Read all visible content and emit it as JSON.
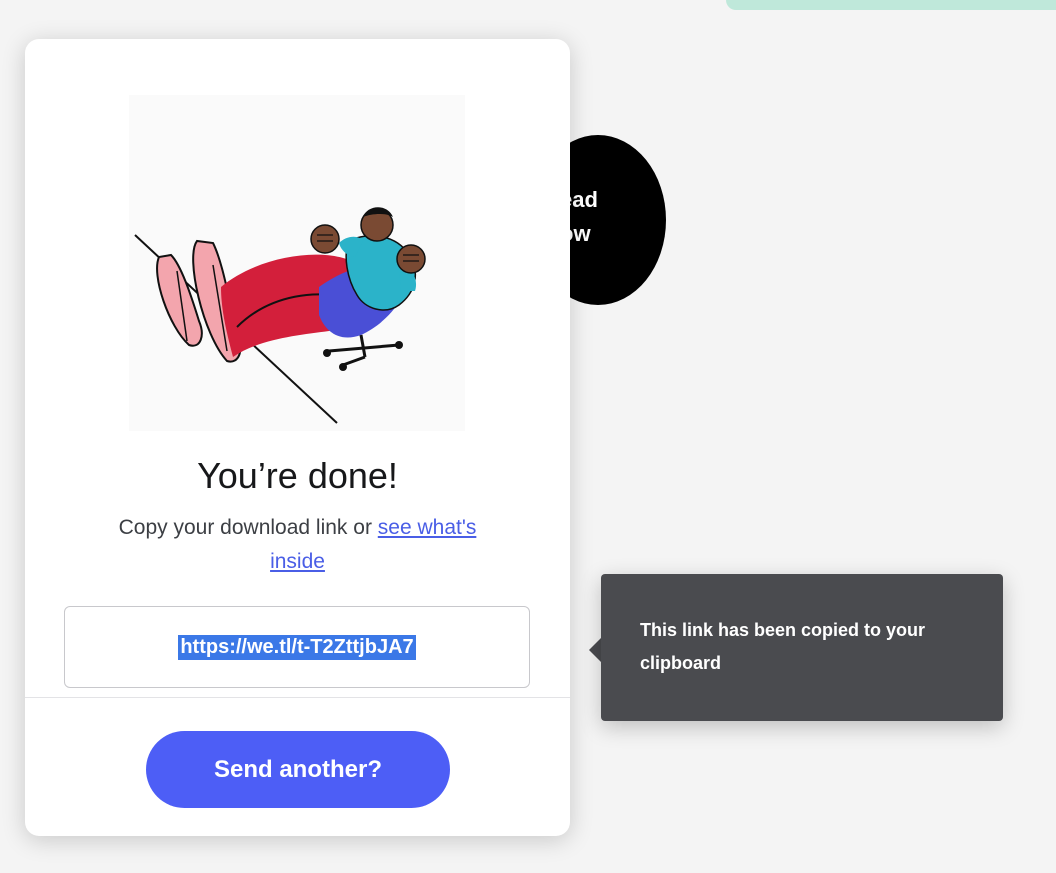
{
  "background_button": {
    "label_line1": "ead",
    "label_line2": "ow"
  },
  "dialog": {
    "title": "You’re done!",
    "subtitle_prefix": "Copy your download link or ",
    "subtitle_link": "see what's inside",
    "link_value": "https://we.tl/t-T2ZttjbJA7",
    "send_another_label": "Send another?"
  },
  "tooltip": {
    "text": "This link has been copied to your clipboard"
  },
  "colors": {
    "accent": "#4d5ef6",
    "link": "#4a5ee6",
    "tooltip_bg": "#4a4b4f",
    "selection": "#3b78e7",
    "top_accent": "#bfe8da"
  },
  "icons": [
    "illustration-person-reclining-icon"
  ]
}
